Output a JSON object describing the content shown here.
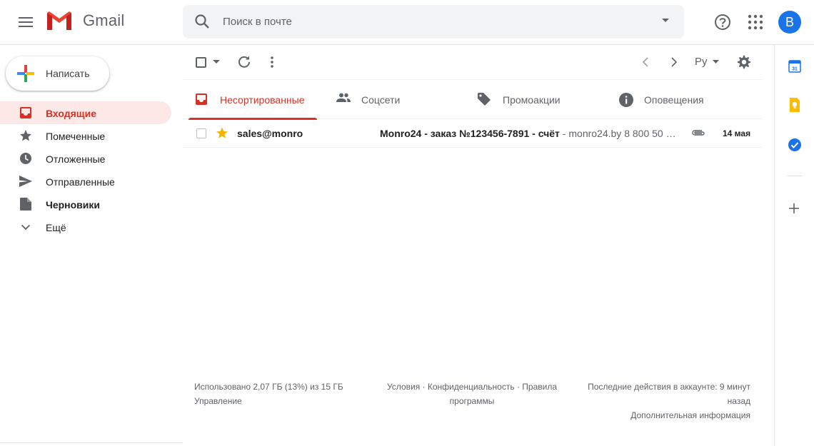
{
  "app": {
    "name": "Gmail"
  },
  "search": {
    "placeholder": "Поиск в почте"
  },
  "header": {
    "avatar_letter": "В"
  },
  "compose": {
    "label": "Написать"
  },
  "sidebar": {
    "items": [
      {
        "label": "Входящие",
        "icon": "inbox-icon",
        "active": true
      },
      {
        "label": "Помеченные",
        "icon": "star-icon"
      },
      {
        "label": "Отложенные",
        "icon": "clock-icon"
      },
      {
        "label": "Отправленные",
        "icon": "send-icon"
      },
      {
        "label": "Черновики",
        "icon": "draft-icon",
        "bold": true
      },
      {
        "label": "Ещё",
        "icon": "chevron-down-icon"
      }
    ]
  },
  "toolbar": {
    "lang": "Ру"
  },
  "tabs": [
    {
      "label": "Несортированные",
      "icon": "inbox-icon",
      "active": true
    },
    {
      "label": "Соцсети",
      "icon": "people-icon"
    },
    {
      "label": "Промоакции",
      "icon": "tag-icon"
    },
    {
      "label": "Оповещения",
      "icon": "info-icon"
    }
  ],
  "emails": [
    {
      "sender": "sales@monro",
      "subject": "Monro24 - заказ №123456-7891 - счёт",
      "separator": " - ",
      "snippet": "monro24.by 8 800 50 …",
      "date": "14 мая",
      "starred": true,
      "has_attachment": true
    }
  ],
  "footer": {
    "storage": "Использовано 2,07 ГБ (13%) из 15 ГБ",
    "manage": "Управление",
    "terms": "Условия",
    "dot1": " · ",
    "privacy": "Конфиденциальность",
    "dot2": " · ",
    "program_policies": "Правила программы",
    "last_activity": "Последние действия в аккаунте: 9 минут назад",
    "details": "Дополнительная информация"
  },
  "colors": {
    "accent_red": "#d93025",
    "active_bg": "#fce8e6",
    "avatar_blue": "#1a73e8",
    "star_yellow": "#f4b400"
  }
}
